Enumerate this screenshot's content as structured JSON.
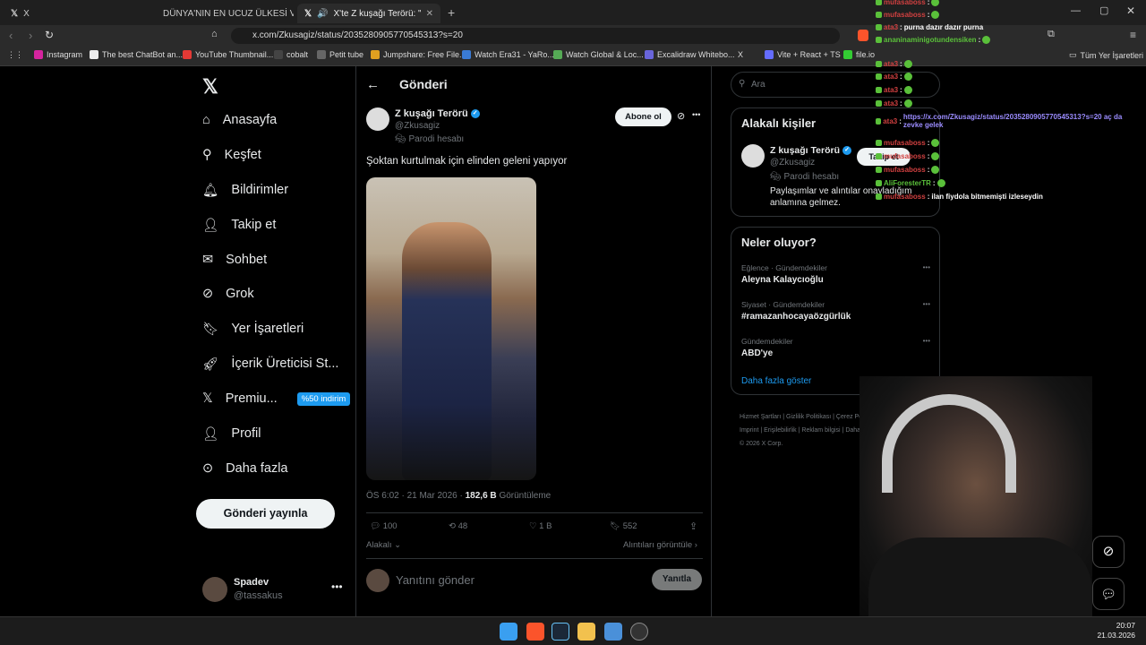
{
  "browser": {
    "tabs": [
      {
        "label": "X",
        "active": false
      },
      {
        "label": "DÜNYA'NIN EN UCUZ ÜLKESİ VİETNA",
        "active": false
      },
      {
        "label": "X'te Z kuşağı Terörü: \"Şoktan",
        "active": true
      }
    ],
    "url": "x.com/Zkusagiz/status/2035280905770545313?s=20",
    "bookmarks": [
      "Instagram",
      "The best ChatBot an...",
      "YouTube Thumbnail...",
      "cobalt",
      "Petit tube",
      "Jumpshare: Free File...",
      "Watch Era31 - YaRo...",
      "Watch Global & Loc...",
      "Excalidraw Whitebo...",
      "X",
      "Vite + React + TS",
      "file.io",
      "Tüm Yer İşaretleri"
    ]
  },
  "nav": {
    "items": [
      "Anasayfa",
      "Keşfet",
      "Bildirimler",
      "Takip et",
      "Sohbet",
      "Grok",
      "Yer İşaretleri",
      "İçerik Üreticisi St...",
      "Premiu...",
      "Profil",
      "Daha fazla"
    ],
    "premium_badge": "%50 indirim",
    "post_button": "Gönderi yayınla",
    "user_name": "Spadev",
    "user_handle": "@tassakus"
  },
  "post": {
    "header": "Gönderi",
    "author_name": "Z kuşağı Terörü",
    "author_handle": "@Zkusagiz",
    "parody": "Parodi hesabı",
    "follow_label": "Abone ol",
    "text": "Şoktan kurtulmak için elinden geleni yapıyor",
    "time": "ÖS 6:02 · 21 Mar 2026 ·",
    "views": "182,6 B",
    "views_label": "Görüntüleme",
    "replies": "100",
    "reposts": "48",
    "likes": "1 B",
    "bookmarks": "552",
    "related_label": "Alakalı",
    "quotes_label": "Alıntıları görüntüle",
    "reply_placeholder": "Yanıtını gönder",
    "reply_button": "Yanıtla"
  },
  "right": {
    "search_placeholder": "Ara",
    "related_title": "Alakalı kişiler",
    "related_name": "Z kuşağı Terörü",
    "related_handle": "@Zkusagiz",
    "related_parody": "Parodi hesabı",
    "related_bio": "Paylaşımlar ve alıntılar onayladığım anlamına gelmez.",
    "related_follow": "Takip et",
    "trends_title": "Neler oluyor?",
    "trends": [
      {
        "category": "Eğlence · Gündemdekiler",
        "topic": "Aleyna Kalaycıoğlu"
      },
      {
        "category": "Siyaset · Gündemdekiler",
        "topic": "#ramazanhocayaözgürlük"
      },
      {
        "category": "Gündemdekiler",
        "topic": "ABD'ye"
      }
    ],
    "show_more": "Daha fazla göster",
    "footer": [
      "Hizmet Şartları",
      "Gizlilik Politikası",
      "Çerez Politikası",
      "Imprint",
      "Erişilebilirlik",
      "Reklam bilgisi",
      "Daha fazla"
    ],
    "copyright": "© 2026 X Corp."
  },
  "chat": [
    {
      "user": "mufasaboss",
      "msg": "",
      "color": "#d04040"
    },
    {
      "user": "mufasaboss",
      "msg": "",
      "color": "#d04040"
    },
    {
      "user": "ata3",
      "msg": "purna dazır dazır purna",
      "color": "#d04040"
    },
    {
      "user": "ananinaminigotundensiken",
      "msg": "",
      "color": "#5ac03a"
    },
    {
      "user": "ata3",
      "msg": "",
      "color": "#d04040"
    },
    {
      "user": "ata3",
      "msg": "",
      "color": "#d04040"
    },
    {
      "user": "ata3",
      "msg": "",
      "color": "#d04040"
    },
    {
      "user": "ata3",
      "msg": "",
      "color": "#d04040"
    },
    {
      "user": "ata3",
      "msg": "https://x.com/Zkusagiz/status/2035280905770545313?s=20 aç da zevke gelek",
      "color": "#d04040"
    },
    {
      "user": "mufasaboss",
      "msg": "",
      "color": "#d04040"
    },
    {
      "user": "mufasaboss",
      "msg": "",
      "color": "#d04040"
    },
    {
      "user": "mufasaboss",
      "msg": "",
      "color": "#d04040"
    },
    {
      "user": "AliForesterTR",
      "msg": "",
      "color": "#5ac03a"
    },
    {
      "user": "mufasaboss",
      "msg": "ilan fiydola bitmemişti izleseydin",
      "color": "#d04040"
    }
  ],
  "taskbar": {
    "time": "20:07",
    "date": "21.03.2026"
  },
  "colors": {
    "accent": "#1d9bf0",
    "bg": "#000000",
    "border": "#2f3336",
    "muted": "#71767b"
  }
}
